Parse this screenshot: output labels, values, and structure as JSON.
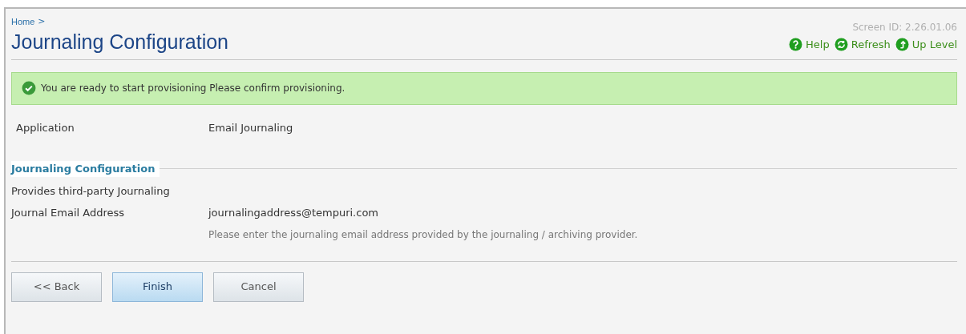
{
  "breadcrumb": {
    "link": "Home",
    "separator": ">"
  },
  "title": "Journaling Configuration",
  "screen_id": "Screen ID:  2.26.01.06",
  "toolbar": [
    {
      "label": "Help",
      "kind": "help"
    },
    {
      "label": "Refresh",
      "kind": "refresh"
    },
    {
      "label": "Up Level",
      "kind": "up"
    }
  ],
  "message": {
    "kind": "success",
    "text": "You are ready to start provisioning Please confirm provisioning."
  },
  "summary": [
    {
      "label": "Application",
      "value": "Email Journaling"
    }
  ],
  "section": {
    "title": "Journaling Configuration",
    "description": "Provides third-party Journaling",
    "fields": [
      {
        "label": "Journal Email Address",
        "value": "journalingaddress@tempuri.com",
        "hint": "Please enter the journaling email address provided by the journaling / archiving provider."
      }
    ]
  },
  "buttons": [
    {
      "label": "<< Back",
      "primary": false
    },
    {
      "label": "Finish",
      "primary": true
    },
    {
      "label": "Cancel",
      "primary": false
    }
  ]
}
